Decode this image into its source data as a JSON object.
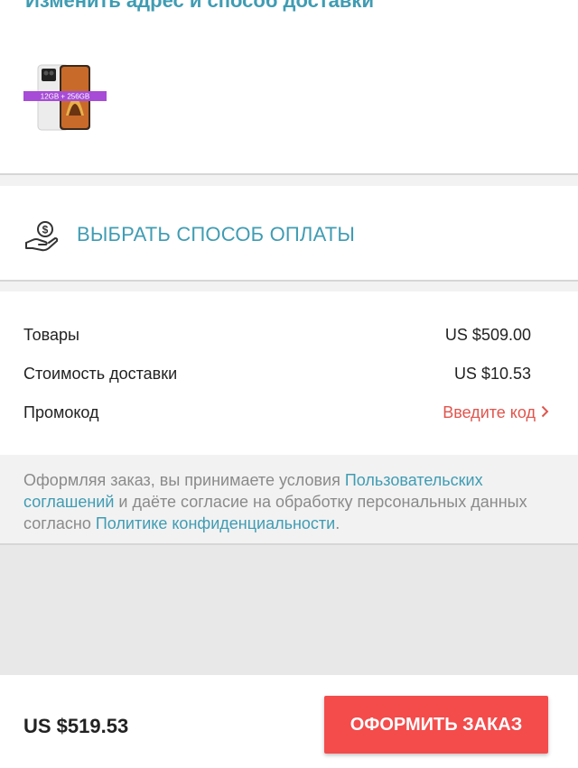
{
  "delivery": {
    "change_link": "Изменить адрес и способ доставки"
  },
  "product": {
    "memory_badge": "12GB + 256GB"
  },
  "payment": {
    "label": "ВЫБРАТЬ СПОСОБ ОПЛАТЫ"
  },
  "summary": {
    "goods_label": "Товары",
    "goods_value": "US $509.00",
    "shipping_label": "Стоимость доставки",
    "shipping_value": "US $10.53",
    "promo_label": "Промокод",
    "promo_action": "Введите код"
  },
  "terms": {
    "part1": "Оформляя заказ, вы принимаете условия ",
    "link1": "Пользовательских соглашений",
    "part2": " и даёте согласие на обработку персональных данных согласно ",
    "link2": "Политике конфиденциальности",
    "part3": "."
  },
  "footer": {
    "total": "US $519.53",
    "place_order": "ОФОРМИТЬ ЗАКАЗ"
  },
  "colors": {
    "accent": "#3f9cb3",
    "promo": "#e0554d",
    "button": "#f44b4b",
    "badge": "#a64cd6"
  }
}
